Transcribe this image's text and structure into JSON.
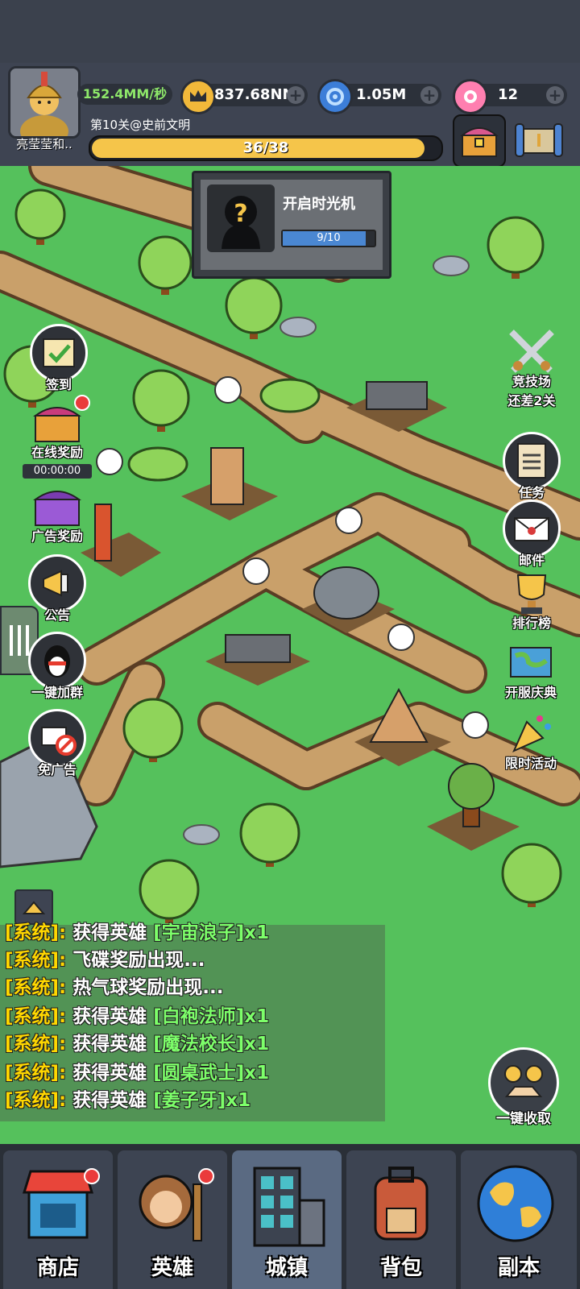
{
  "player": {
    "name": "亮莹莹和..",
    "rate": "152.4MM/秒"
  },
  "resources": {
    "gold": "837.68NN",
    "gems": "1.05M",
    "candy": "12"
  },
  "level": {
    "label": "第10关@史前文明",
    "progress_text": "36/38",
    "progress_fraction": 0.947
  },
  "quest": {
    "title": "开启时光机",
    "progress_text": "9/10",
    "progress_fraction": 0.9,
    "icon": "question-mark-silhouette"
  },
  "left_menu": {
    "checkin": "签到",
    "online_reward": "在线奖励",
    "timer": "00:00:00",
    "ad_reward": "广告奖励",
    "notice": "公告",
    "join_group": "一键加群",
    "no_ads": "免广告"
  },
  "right_menu": {
    "arena": "竞技场",
    "arena_sub": "还差2关",
    "tasks": "任务",
    "mail": "邮件",
    "ranking": "排行榜",
    "celebration": "开服庆典",
    "limited_event": "限时活动"
  },
  "chat": [
    {
      "tag": "[系统]:",
      "msg": " 获得英雄 ",
      "hero": "[宇宙浪子]x1"
    },
    {
      "tag": "[系统]:",
      "msg": " 飞碟奖励出现...",
      "hero": ""
    },
    {
      "tag": "[系统]:",
      "msg": " 热气球奖励出现...",
      "hero": ""
    },
    {
      "tag": "[系统]:",
      "msg": " 获得英雄 ",
      "hero": "[白袍法师]x1"
    },
    {
      "tag": "[系统]:",
      "msg": " 获得英雄 ",
      "hero": "[魔法校长]x1"
    },
    {
      "tag": "[系统]:",
      "msg": " 获得英雄 ",
      "hero": "[圆桌武士]x1"
    },
    {
      "tag": "[系统]:",
      "msg": " 获得英雄 ",
      "hero": "[姜子牙]x1"
    }
  ],
  "collect_all": "一键收取",
  "bottom_nav": [
    {
      "label": "商店",
      "icon": "shop-icon"
    },
    {
      "label": "英雄",
      "icon": "hero-icon"
    },
    {
      "label": "城镇",
      "icon": "town-icon"
    },
    {
      "label": "背包",
      "icon": "backpack-icon"
    },
    {
      "label": "副本",
      "icon": "globe-icon"
    }
  ],
  "colors": {
    "grass": "#55c15c",
    "path": "#c9a06a",
    "gold": "#f5c54a",
    "progress_blue": "#4a87d2",
    "chat_hero": "#7dff6a",
    "chat_tag": "#ffd700"
  }
}
